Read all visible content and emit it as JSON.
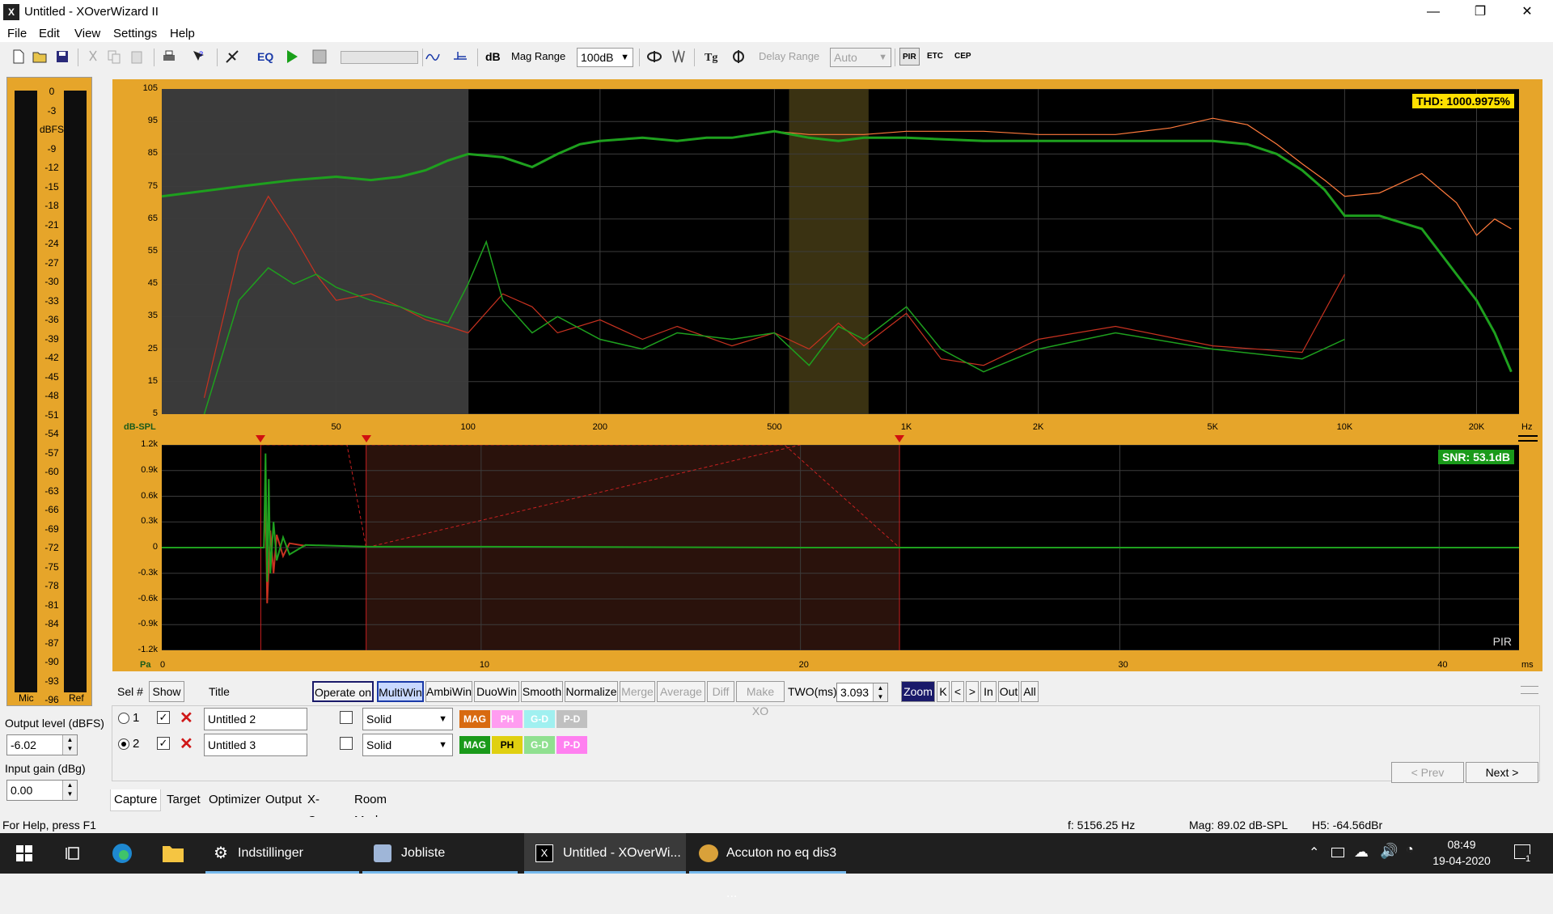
{
  "window": {
    "title": "Untitled - XOverWizard II",
    "app_icon": "X",
    "minimize": "—",
    "restore": "❐",
    "close": "✕"
  },
  "menu": [
    "File",
    "Edit",
    "View",
    "Settings",
    "Help"
  ],
  "toolbar": {
    "eq": "EQ",
    "db": "dB",
    "mag_range_label": "Mag Range",
    "mag_range_value": "100dB",
    "delay_range_label": "Delay Range",
    "delay_range_value": "Auto",
    "pir": "PIR",
    "etc": "ETC",
    "cep": "CEP"
  },
  "meters": {
    "scale": [
      "0",
      "-3",
      "dBFS",
      "-9",
      "-12",
      "-15",
      "-18",
      "-21",
      "-24",
      "-27",
      "-30",
      "-33",
      "-36",
      "-39",
      "-42",
      "-45",
      "-48",
      "-51",
      "-54",
      "-57",
      "-60",
      "-63",
      "-66",
      "-69",
      "-72",
      "-75",
      "-78",
      "-81",
      "-84",
      "-87",
      "-90",
      "-93",
      "-96"
    ],
    "left_label": "Mic",
    "right_label": "Ref"
  },
  "output_level": {
    "label": "Output level (dBFS)",
    "value": "-6.02"
  },
  "input_gain": {
    "label": "Input gain (dBg)",
    "value": "0.00"
  },
  "top_plot": {
    "thd": "THD: 1000.9975%",
    "y_ticks": [
      "105",
      "95",
      "85",
      "75",
      "65",
      "55",
      "45",
      "35",
      "25",
      "15",
      "5"
    ],
    "x_ticks": [
      "50",
      "100",
      "200",
      "500",
      "1K",
      "2K",
      "5K",
      "10K",
      "20K"
    ],
    "y_unit": "dB-SPL",
    "x_unit": "Hz"
  },
  "bottom_plot": {
    "snr": "SNR: 53.1dB",
    "y_ticks": [
      "1.2k",
      "0.9k",
      "0.6k",
      "0.3k",
      "0",
      "-0.3k",
      "-0.6k",
      "-0.9k",
      "-1.2k"
    ],
    "x_ticks": [
      "0",
      "10",
      "20",
      "30",
      "40"
    ],
    "y_unit": "Pa",
    "x_unit": "ms",
    "mode": "PIR"
  },
  "chart_data": [
    {
      "type": "line",
      "xlabel": "Hz",
      "ylabel": "dB-SPL",
      "xscale": "log",
      "ylim": [
        5,
        105
      ],
      "xlim": [
        20,
        25000
      ],
      "series": [
        {
          "color": "#1ea01e",
          "x": [
            20,
            30,
            40,
            50,
            60,
            70,
            80,
            90,
            100,
            120,
            140,
            160,
            180,
            200,
            250,
            300,
            350,
            400,
            500,
            600,
            700,
            800,
            1000,
            1500,
            2000,
            3000,
            4000,
            5000,
            6000,
            7000,
            8000,
            9000,
            10000,
            12000,
            15000,
            18000,
            20000,
            22000,
            24000
          ],
          "y": [
            72,
            75,
            77,
            78,
            77,
            78,
            80,
            83,
            85,
            84,
            81,
            85,
            88,
            89,
            90,
            89,
            90,
            90,
            92,
            90,
            89,
            90,
            90,
            89,
            89,
            89,
            89,
            89,
            88,
            85,
            80,
            74,
            66,
            66,
            62,
            48,
            40,
            30,
            18
          ]
        },
        {
          "color": "#ff7a3c",
          "x": [
            20,
            30,
            40,
            50,
            60,
            70,
            80,
            90,
            100,
            120,
            140,
            160,
            180,
            200,
            250,
            300,
            350,
            400,
            500,
            600,
            700,
            800,
            1000,
            1500,
            2000,
            3000,
            4000,
            5000,
            6000,
            7000,
            8000,
            9000,
            10000,
            12000,
            15000,
            18000,
            20000,
            22000,
            24000
          ],
          "y": [
            72,
            75,
            77,
            78,
            77,
            78,
            80,
            83,
            85,
            84,
            81,
            85,
            88,
            89,
            90,
            89,
            90,
            90,
            92,
            91,
            91,
            91,
            92,
            92,
            91,
            91,
            93,
            96,
            94,
            88,
            82,
            77,
            72,
            73,
            79,
            70,
            60,
            65,
            62
          ]
        },
        {
          "color": "#1ea01e",
          "x": [
            25,
            30,
            35,
            40,
            45,
            50,
            60,
            70,
            80,
            90,
            100,
            110,
            120,
            140,
            160,
            200,
            250,
            300,
            400,
            500,
            600,
            700,
            800,
            1000,
            1200,
            1500,
            2000,
            3000,
            5000,
            8000,
            10000
          ],
          "y": [
            5,
            40,
            50,
            45,
            48,
            44,
            40,
            38,
            35,
            33,
            45,
            58,
            40,
            30,
            35,
            28,
            25,
            30,
            28,
            30,
            20,
            32,
            28,
            38,
            25,
            18,
            25,
            30,
            25,
            22,
            28
          ]
        },
        {
          "color": "#c83220",
          "x": [
            25,
            30,
            35,
            40,
            45,
            50,
            60,
            70,
            80,
            90,
            100,
            120,
            140,
            160,
            200,
            250,
            300,
            400,
            500,
            600,
            700,
            800,
            1000,
            1200,
            1500,
            2000,
            3000,
            5000,
            8000,
            10000
          ],
          "y": [
            10,
            55,
            72,
            60,
            48,
            40,
            42,
            38,
            34,
            32,
            30,
            42,
            38,
            30,
            34,
            28,
            32,
            26,
            30,
            25,
            33,
            26,
            36,
            22,
            20,
            28,
            32,
            26,
            24,
            48
          ]
        }
      ]
    },
    {
      "type": "line",
      "xlabel": "ms",
      "ylabel": "Pa",
      "ylim": [
        -1.2,
        1.2
      ],
      "xlim": [
        0,
        42.5
      ],
      "series": [
        {
          "color": "#1ea01e",
          "x": [
            0,
            3.2,
            3.25,
            3.3,
            3.35,
            3.4,
            3.5,
            3.6,
            3.8,
            4.0,
            4.5,
            6.5,
            10,
            20,
            30,
            42.5
          ],
          "y": [
            0,
            0,
            1.1,
            -0.4,
            0.8,
            -0.3,
            0.3,
            -0.15,
            0.12,
            -0.08,
            0.03,
            0.01,
            0.01,
            0,
            0,
            0
          ]
        },
        {
          "color": "#c83220",
          "x": [
            3.2,
            3.25,
            3.3,
            3.4,
            3.5,
            3.6,
            3.8,
            4.0,
            4.5
          ],
          "y": [
            0,
            0.6,
            -0.65,
            0.2,
            -0.3,
            0.15,
            -0.1,
            0.05,
            0.02
          ]
        }
      ]
    }
  ],
  "selection": {
    "headers": {
      "sel": "Sel #",
      "show": "Show",
      "title": "Title"
    },
    "rows": [
      {
        "num": "1",
        "title": "Untitled 2",
        "style": "Solid",
        "pills": [
          "MAG",
          "PH",
          "G-D",
          "P-D"
        ]
      },
      {
        "num": "2",
        "title": "Untitled 3",
        "style": "Solid",
        "pills": [
          "MAG",
          "PH",
          "G-D",
          "P-D"
        ]
      }
    ]
  },
  "buttons": {
    "operate_on": "Operate on",
    "multiwin": "MultiWin",
    "ambiwin": "AmbiWin",
    "duowin": "DuoWin",
    "smooth": "Smooth",
    "normalize": "Normalize",
    "merge": "Merge",
    "average": "Average",
    "diff": "Diff",
    "make_xo": "Make XO",
    "two_label": "TWO(ms)",
    "two_value": "3.093",
    "zoom": "Zoom",
    "k": "K",
    "lt": "<",
    "gt": ">",
    "in": "In",
    "out": "Out",
    "all": "All",
    "prev": "< Prev",
    "next": "Next >"
  },
  "tabs": [
    "Capture",
    "Target",
    "Optimizer",
    "Output",
    "X-Over",
    "Room Modes"
  ],
  "status": {
    "help": "For Help, press F1",
    "freq": "f: 5156.25 Hz",
    "mag": "Mag: 89.02 dB-SPL",
    "h5": "H5: -64.56dBr"
  },
  "taskbar": {
    "items": [
      "Indstillinger",
      "Jobliste",
      "Untitled - XOverWi...",
      "Accuton no eq dis3 ..."
    ],
    "time": "08:49",
    "date": "19-04-2020",
    "notif": "1"
  }
}
